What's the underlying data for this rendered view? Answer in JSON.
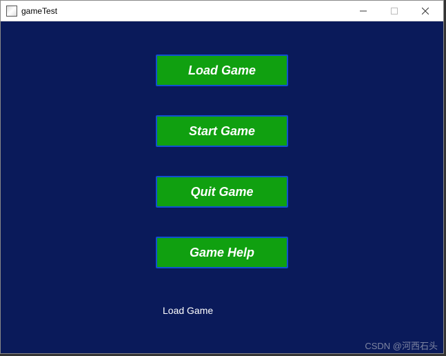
{
  "window": {
    "title": "gameTest"
  },
  "menu": {
    "load_label": "Load Game",
    "start_label": "Start Game",
    "quit_label": "Quit Game",
    "help_label": "Game Help"
  },
  "status": {
    "text": "Load Game"
  },
  "watermark": {
    "text": "CSDN @河西石头"
  }
}
